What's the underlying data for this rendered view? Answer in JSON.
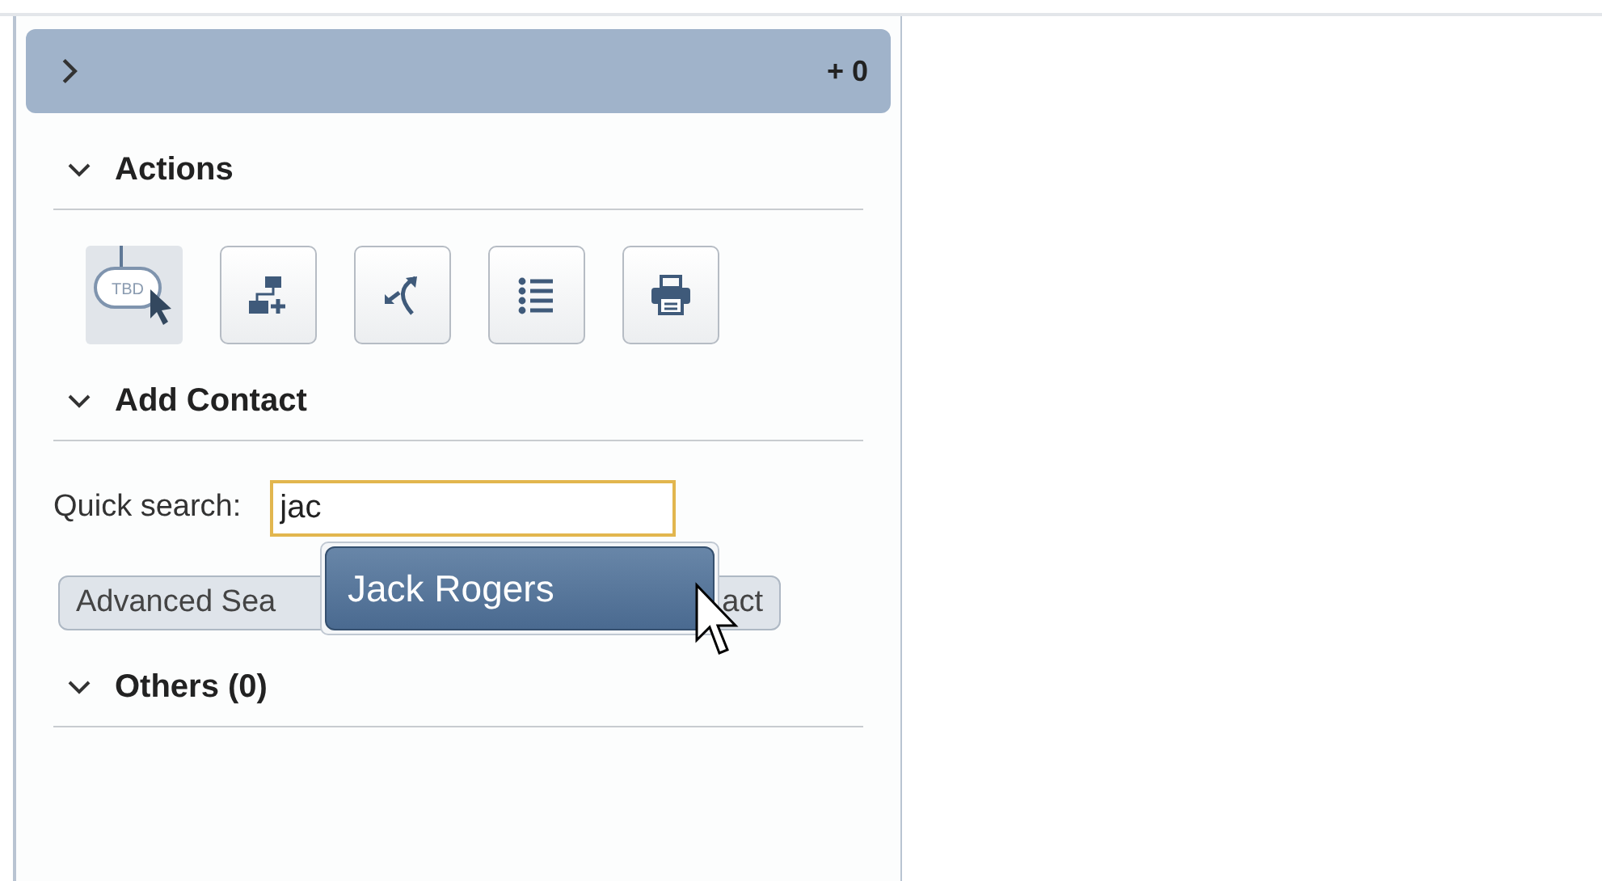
{
  "header": {
    "expanded": false,
    "count": "+ 0"
  },
  "sections": [
    {
      "title": "Actions",
      "expanded": true,
      "kind": "actions",
      "actions": [
        {
          "kind": "tbd",
          "selected": true,
          "label": "TBD"
        },
        {
          "kind": "add-flow",
          "selected": false
        },
        {
          "kind": "branch",
          "selected": false
        },
        {
          "kind": "list",
          "selected": false
        },
        {
          "kind": "print",
          "selected": false
        }
      ]
    },
    {
      "title": "Add Contact",
      "expanded": true,
      "kind": "contact",
      "search": {
        "label": "Quick search:",
        "value": "jac"
      },
      "suggestions": [
        {
          "text": "Jack Rogers",
          "selected": true
        }
      ],
      "buttons": [
        "Advanced Sea",
        "act"
      ]
    },
    {
      "title": "Others (0)",
      "expanded": true,
      "kind": "empty"
    }
  ]
}
